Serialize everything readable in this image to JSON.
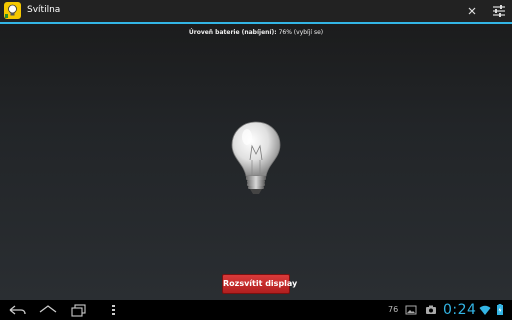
{
  "app": {
    "title": "Svítilna",
    "icon": "lightbulb-app-icon",
    "accent_color": "#33b5e5"
  },
  "action_bar": {
    "close_icon": "close-icon",
    "settings_icon": "settings-sliders-icon"
  },
  "battery": {
    "label": "Úroveň baterie (nabíjení):",
    "value": "76% (vybíjí se)"
  },
  "main": {
    "bulb_icon": "lightbulb-icon",
    "button_label": "Rozsvítit display",
    "button_color": "#c62828"
  },
  "system_bar": {
    "nav": [
      "back-icon",
      "home-icon",
      "recent-apps-icon",
      "menu-icon"
    ],
    "battery_level": "76",
    "clock": "0:24",
    "clock_color": "#33b5e5"
  }
}
